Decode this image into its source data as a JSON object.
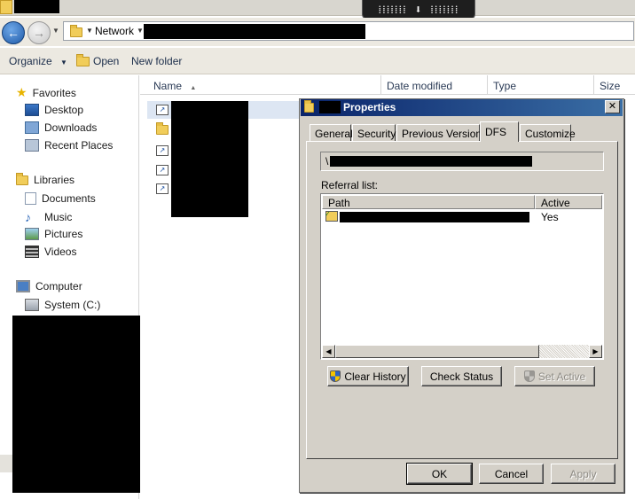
{
  "remote_bar": {
    "label": "⁞⁞⁞⁞⁞⁞⁞ ⬇ ⁞⁞⁞⁞⁞⁞⁞"
  },
  "address": {
    "crumb": "Network"
  },
  "toolbar": {
    "organize": "Organize",
    "open": "Open",
    "new_folder": "New folder"
  },
  "sidebar": {
    "favorites": {
      "label": "Favorites",
      "items": [
        "Desktop",
        "Downloads",
        "Recent Places"
      ]
    },
    "libraries": {
      "label": "Libraries",
      "items": [
        "Documents",
        "Music",
        "Pictures",
        "Videos"
      ]
    },
    "computer": {
      "label": "Computer",
      "items": [
        "System (C:)"
      ]
    }
  },
  "columns": {
    "name": "Name",
    "date_modified": "Date modified",
    "type": "Type",
    "size": "Size"
  },
  "dialog": {
    "title": "Properties",
    "tabs": [
      "General",
      "Security",
      "Previous Versions",
      "DFS",
      "Customize"
    ],
    "active_tab": "DFS",
    "unc_prefix": "\\",
    "referral_label": "Referral list:",
    "list_headers": {
      "path": "Path",
      "active": "Active"
    },
    "rows": [
      {
        "active": "Yes"
      }
    ],
    "buttons": {
      "clear_history": "Clear History",
      "check_status": "Check Status",
      "set_active": "Set Active",
      "ok": "OK",
      "cancel": "Cancel",
      "apply": "Apply"
    }
  },
  "colors": {
    "dialog_title_start": "#0a246a",
    "dialog_title_end": "#3a6ea5",
    "face": "#d4d0c8"
  }
}
